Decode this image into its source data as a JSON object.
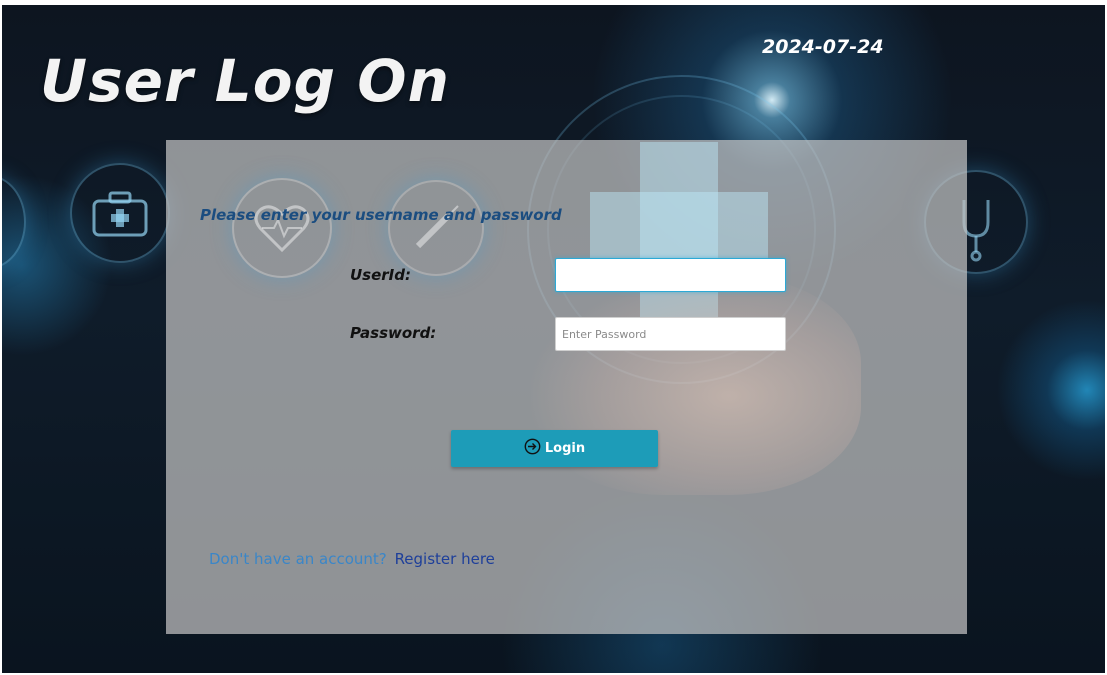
{
  "header": {
    "title": "User Log On",
    "date": "2024-07-24"
  },
  "form": {
    "instruction": "Please enter your username and password",
    "userid_label": "UserId:",
    "userid_value": "",
    "password_label": "Password:",
    "password_placeholder": "Enter Password",
    "login_label": "Login",
    "login_icon": "sign-in-icon"
  },
  "footer": {
    "register_prompt": "Don't have an account?",
    "register_link": "Register here"
  },
  "colors": {
    "accent": "#1d9cb8",
    "instruction_text": "#1b4d80",
    "link": "#1e3f9a"
  }
}
